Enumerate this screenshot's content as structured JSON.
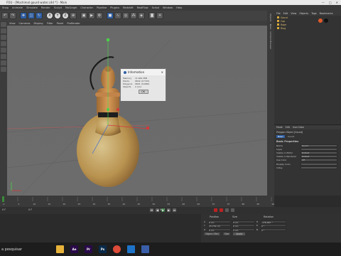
{
  "titlebar": {
    "title": "FOU - [Mochimol gourd water.c4d *] - Main",
    "controls": [
      "—",
      "□",
      "✕"
    ]
  },
  "menubar": [
    "Snap",
    "Animate",
    "Simulate",
    "Render",
    "Sculpt",
    "MoGraph",
    "Character",
    "Pipeline",
    "Plugins",
    "Redshift",
    "RealFlow",
    "Script",
    "Window",
    "Help"
  ],
  "toolbar": {
    "buttons": [
      "undo",
      "redo",
      "move",
      "scale",
      "rotate",
      "X",
      "Y",
      "Z",
      "world",
      "render-view",
      "render",
      "render-settings",
      "cube",
      "spline",
      "nurbs",
      "array",
      "deformer",
      "camera",
      "light"
    ],
    "xyz": [
      "X",
      "Y",
      "Z"
    ]
  },
  "viewport_menu": [
    "View",
    "Cameras",
    "Display",
    "Filter",
    "Panel",
    "ProRender"
  ],
  "object_manager": {
    "tabs": [
      "File",
      "Edit",
      "View",
      "Objects",
      "Tags",
      "Bookmarks"
    ],
    "objects": [
      "Gourd",
      "Cap",
      "Rope",
      "Ring"
    ]
  },
  "right_strip_tabs": [
    "Objects",
    "Takes",
    "Content Browser",
    "Structure",
    "Layers"
  ],
  "attributes": {
    "tabs": [
      "Mode",
      "Edit",
      "User Data"
    ],
    "object_line": "Polygon Object [Gourd]",
    "subtabs": [
      "Basic",
      "Coord."
    ],
    "section": "Basic Properties",
    "rows": [
      {
        "label": "Name",
        "value": "Gourd"
      },
      {
        "label": "Layer",
        "value": ""
      },
      {
        "label": "Visible in Editor",
        "value": "Default"
      },
      {
        "label": "Visible in Renderer",
        "value": "Default"
      },
      {
        "label": "Use Color",
        "value": "Off"
      },
      {
        "label": "Display Color",
        "value": ""
      },
      {
        "label": "X-Ray",
        "value": ""
      }
    ],
    "multi": "<< Multiple Values >>"
  },
  "dialog": {
    "title": "Information",
    "rows": [
      {
        "k": "Memory",
        "v": "11.961 MiB"
      },
      {
        "k": "Points",
        "v": "9842 (17725)"
      },
      {
        "k": "Polygons",
        "v": "9801 (10480)"
      },
      {
        "k": "Objects",
        "v": "2 (11)"
      }
    ],
    "ok": "OK"
  },
  "timeline": {
    "ticks": [
      "0",
      "5",
      "10",
      "15",
      "20",
      "25",
      "30",
      "35",
      "40",
      "45",
      "50",
      "55",
      "60",
      "65",
      "70",
      "75",
      "80",
      "85",
      "90"
    ],
    "current": "0 F",
    "end": "90 F",
    "start": "0 F"
  },
  "coords": {
    "headers": [
      "Position",
      "Size",
      "Rotation"
    ],
    "rows": [
      {
        "axis": "X",
        "pos": "0 cm",
        "size": "0 cm",
        "rot": "H",
        "rv": "-178.967 °"
      },
      {
        "axis": "Y",
        "pos": "15.732 cm",
        "size": "0 cm",
        "rot": "P",
        "rv": "0 °"
      },
      {
        "axis": "Z",
        "pos": "0 cm",
        "size": "0 cm",
        "rot": "B",
        "rv": "0 °"
      }
    ],
    "mode": "Object (Rel)",
    "mode2": "Size",
    "apply": "Apply"
  },
  "taskbar": {
    "search": "a pesquisar",
    "apps": [
      {
        "name": "file-explorer",
        "label": "",
        "color": "#e8b33a"
      },
      {
        "name": "after-effects",
        "label": "Ae",
        "color": "#2a0a4a"
      },
      {
        "name": "premiere",
        "label": "Pr",
        "color": "#2a0a4a"
      },
      {
        "name": "photoshop",
        "label": "Ps",
        "color": "#0a2a4a"
      },
      {
        "name": "chrome",
        "label": "",
        "color": "#dd4b39"
      },
      {
        "name": "vscode",
        "label": "",
        "color": "#1e73c8"
      },
      {
        "name": "cinema4d",
        "label": "",
        "color": "#3a5ea8"
      }
    ]
  }
}
